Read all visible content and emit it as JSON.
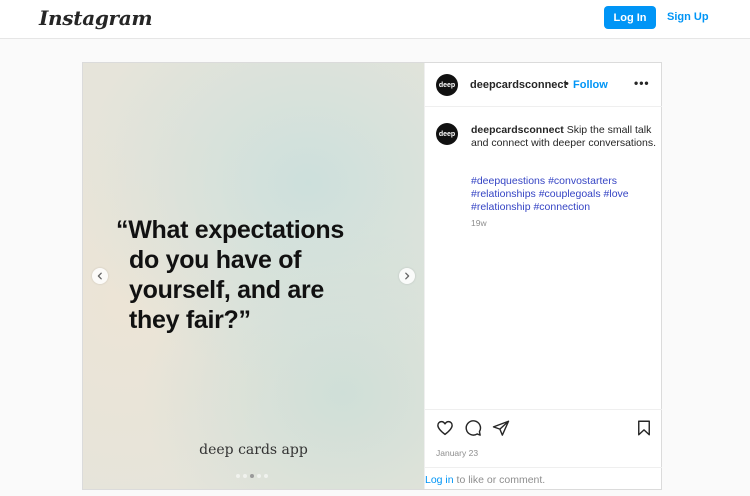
{
  "nav": {
    "logo": "Instagram",
    "login_label": "Log In",
    "signup_label": "Sign Up"
  },
  "post": {
    "username": "deepcardsconnect",
    "avatar_text": "deep",
    "separator": "•",
    "follow_label": "Follow",
    "more_label": "•••",
    "media": {
      "quote_lines": [
        "“What expectations",
        "do you have of",
        "yourself, and are",
        "they fair?”"
      ],
      "app_name": "deep cards app",
      "carousel_dots": 5,
      "active_dot": 2
    },
    "caption": {
      "username": "deepcardsconnect",
      "text": "Skip the small talk and connect with deeper conversations.",
      "hashtags": [
        "#deepquestions",
        "#convostarters",
        "#relationships",
        "#couplegoals",
        "#love",
        "#relationship",
        "#connection"
      ],
      "age": "19w"
    },
    "icons": [
      "heart-icon",
      "comment-icon",
      "share-icon",
      "bookmark-icon"
    ],
    "date": "January 23",
    "footer": {
      "login_link": "Log in",
      "rest": " to like or comment."
    }
  },
  "colors": {
    "accent": "#0095f6",
    "hashtag": "#3544c4",
    "border": "#dbdbdb"
  }
}
